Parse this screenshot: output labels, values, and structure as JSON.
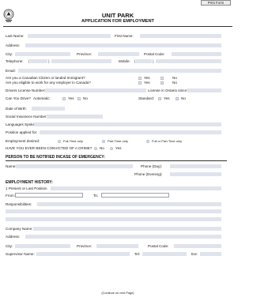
{
  "print_button": "Print Form",
  "header": {
    "org": "UNIT PARK",
    "form_title": "APPLICATION FOR EMPLOYMENT"
  },
  "personal": {
    "last_name": "Last Name:",
    "first_name": "First Name:",
    "address": "Address:",
    "city": "City:",
    "province": "Province:",
    "postal_code": "Postal Code:",
    "telephone": "Telephone:",
    "mobile": "Mobile:",
    "email": "Email:",
    "citizen_q": "Are you a Canadian Citizen or landed Immigrant?",
    "eligible_q": "Are you eligible to work for any employer in Canada?",
    "yes": "Yes",
    "no": "No",
    "license_no": "Drivers License Number:",
    "license_since": "License in Ontario since:",
    "can_drive": "Can You Drive?",
    "automatic": "Automatic:",
    "standard": "Standard:",
    "dob": "Date of Birth:",
    "sin": "Social Insurance Number:",
    "languages": "Languages Spoken:",
    "position": "Position applied for:",
    "employment_desired": "Employment desired:",
    "full_time": "Full-Time only",
    "part_time": "Part-Time only",
    "full_or_part": "Full or Part-Time only",
    "convicted": "HAVE YOU EVER BEEN CONVICTED OF A CRIME?"
  },
  "emergency": {
    "heading": "PERSON TO BE NOTIFIED INCASE OF EMERGENCY:",
    "name": "Name:",
    "phone_day": "Phone (Day):",
    "phone_evening": "Phone (Evening):"
  },
  "history": {
    "heading": "EMPLOYMENT HISTORY:",
    "present_last": "1 Present or Last Position",
    "from": "From:",
    "to": "To:",
    "responsibilities": "Responsibilities:",
    "company": "Company Name:",
    "address": "Address:",
    "city": "City:",
    "province": "Province:",
    "postal_code": "Postal Code:",
    "supervisor": "Supervisor Name:",
    "tel": "Tel:",
    "ext": "Ext:"
  },
  "footer": "(Continue on next Page)"
}
